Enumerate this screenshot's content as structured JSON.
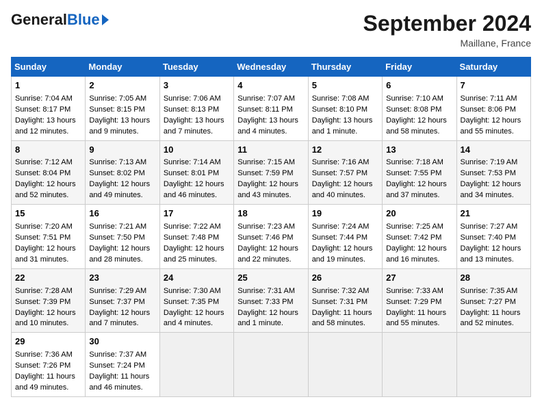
{
  "header": {
    "logo_general": "General",
    "logo_blue": "Blue",
    "month_title": "September 2024",
    "location": "Maillane, France"
  },
  "days_of_week": [
    "Sunday",
    "Monday",
    "Tuesday",
    "Wednesday",
    "Thursday",
    "Friday",
    "Saturday"
  ],
  "weeks": [
    [
      {
        "day": 1,
        "sunrise": "7:04 AM",
        "sunset": "8:17 PM",
        "daylight": "13 hours and 12 minutes."
      },
      {
        "day": 2,
        "sunrise": "7:05 AM",
        "sunset": "8:15 PM",
        "daylight": "13 hours and 9 minutes."
      },
      {
        "day": 3,
        "sunrise": "7:06 AM",
        "sunset": "8:13 PM",
        "daylight": "13 hours and 7 minutes."
      },
      {
        "day": 4,
        "sunrise": "7:07 AM",
        "sunset": "8:11 PM",
        "daylight": "13 hours and 4 minutes."
      },
      {
        "day": 5,
        "sunrise": "7:08 AM",
        "sunset": "8:10 PM",
        "daylight": "13 hours and 1 minute."
      },
      {
        "day": 6,
        "sunrise": "7:10 AM",
        "sunset": "8:08 PM",
        "daylight": "12 hours and 58 minutes."
      },
      {
        "day": 7,
        "sunrise": "7:11 AM",
        "sunset": "8:06 PM",
        "daylight": "12 hours and 55 minutes."
      }
    ],
    [
      {
        "day": 8,
        "sunrise": "7:12 AM",
        "sunset": "8:04 PM",
        "daylight": "12 hours and 52 minutes."
      },
      {
        "day": 9,
        "sunrise": "7:13 AM",
        "sunset": "8:02 PM",
        "daylight": "12 hours and 49 minutes."
      },
      {
        "day": 10,
        "sunrise": "7:14 AM",
        "sunset": "8:01 PM",
        "daylight": "12 hours and 46 minutes."
      },
      {
        "day": 11,
        "sunrise": "7:15 AM",
        "sunset": "7:59 PM",
        "daylight": "12 hours and 43 minutes."
      },
      {
        "day": 12,
        "sunrise": "7:16 AM",
        "sunset": "7:57 PM",
        "daylight": "12 hours and 40 minutes."
      },
      {
        "day": 13,
        "sunrise": "7:18 AM",
        "sunset": "7:55 PM",
        "daylight": "12 hours and 37 minutes."
      },
      {
        "day": 14,
        "sunrise": "7:19 AM",
        "sunset": "7:53 PM",
        "daylight": "12 hours and 34 minutes."
      }
    ],
    [
      {
        "day": 15,
        "sunrise": "7:20 AM",
        "sunset": "7:51 PM",
        "daylight": "12 hours and 31 minutes."
      },
      {
        "day": 16,
        "sunrise": "7:21 AM",
        "sunset": "7:50 PM",
        "daylight": "12 hours and 28 minutes."
      },
      {
        "day": 17,
        "sunrise": "7:22 AM",
        "sunset": "7:48 PM",
        "daylight": "12 hours and 25 minutes."
      },
      {
        "day": 18,
        "sunrise": "7:23 AM",
        "sunset": "7:46 PM",
        "daylight": "12 hours and 22 minutes."
      },
      {
        "day": 19,
        "sunrise": "7:24 AM",
        "sunset": "7:44 PM",
        "daylight": "12 hours and 19 minutes."
      },
      {
        "day": 20,
        "sunrise": "7:25 AM",
        "sunset": "7:42 PM",
        "daylight": "12 hours and 16 minutes."
      },
      {
        "day": 21,
        "sunrise": "7:27 AM",
        "sunset": "7:40 PM",
        "daylight": "12 hours and 13 minutes."
      }
    ],
    [
      {
        "day": 22,
        "sunrise": "7:28 AM",
        "sunset": "7:39 PM",
        "daylight": "12 hours and 10 minutes."
      },
      {
        "day": 23,
        "sunrise": "7:29 AM",
        "sunset": "7:37 PM",
        "daylight": "12 hours and 7 minutes."
      },
      {
        "day": 24,
        "sunrise": "7:30 AM",
        "sunset": "7:35 PM",
        "daylight": "12 hours and 4 minutes."
      },
      {
        "day": 25,
        "sunrise": "7:31 AM",
        "sunset": "7:33 PM",
        "daylight": "12 hours and 1 minute."
      },
      {
        "day": 26,
        "sunrise": "7:32 AM",
        "sunset": "7:31 PM",
        "daylight": "11 hours and 58 minutes."
      },
      {
        "day": 27,
        "sunrise": "7:33 AM",
        "sunset": "7:29 PM",
        "daylight": "11 hours and 55 minutes."
      },
      {
        "day": 28,
        "sunrise": "7:35 AM",
        "sunset": "7:27 PM",
        "daylight": "11 hours and 52 minutes."
      }
    ],
    [
      {
        "day": 29,
        "sunrise": "7:36 AM",
        "sunset": "7:26 PM",
        "daylight": "11 hours and 49 minutes."
      },
      {
        "day": 30,
        "sunrise": "7:37 AM",
        "sunset": "7:24 PM",
        "daylight": "11 hours and 46 minutes."
      },
      null,
      null,
      null,
      null,
      null
    ]
  ]
}
